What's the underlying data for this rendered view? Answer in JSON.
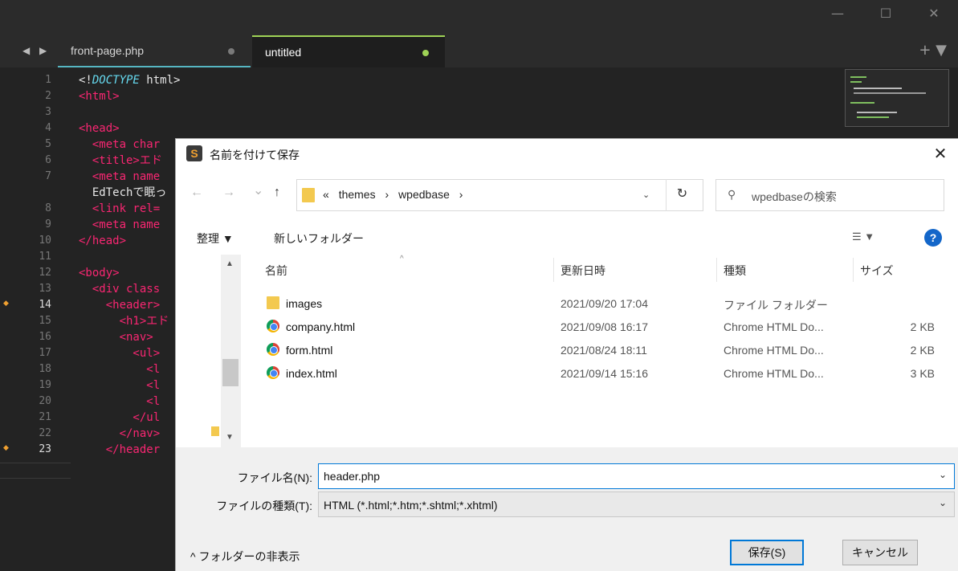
{
  "editor": {
    "window_controls": [
      "—",
      "☐",
      "✕"
    ],
    "nav_arrows": "◀ ▶",
    "tabs": [
      {
        "label": "front-page.php"
      },
      {
        "label": "untitled"
      }
    ],
    "tab_plus": "+ ▼",
    "line_numbers": [
      "1",
      "2",
      "3",
      "4",
      "5",
      "6",
      "7",
      "",
      "8",
      "9",
      "10",
      "11",
      "12",
      "13",
      "14",
      "15",
      "16",
      "17",
      "18",
      "19",
      "20",
      "21",
      "22",
      "23"
    ],
    "code_lines": [
      [
        "<!",
        "DOCTYPE",
        " html>"
      ],
      [
        "<html>"
      ],
      [
        ""
      ],
      [
        "<head>"
      ],
      [
        "  <meta char"
      ],
      [
        "  <title>エド"
      ],
      [
        "  <meta name"
      ],
      [
        "  EdTechで眠っ"
      ],
      [
        "  <link rel="
      ],
      [
        "  <meta name"
      ],
      [
        "</head>"
      ],
      [
        ""
      ],
      [
        "<body>"
      ],
      [
        "  <div class"
      ],
      [
        "    <header>"
      ],
      [
        "      <h1>エド"
      ],
      [
        "      <nav>"
      ],
      [
        "        <ul>"
      ],
      [
        "          <l"
      ],
      [
        "          <l"
      ],
      [
        "          <l"
      ],
      [
        "        </ul"
      ],
      [
        "      </nav>"
      ],
      [
        "    </header"
      ]
    ]
  },
  "dialog": {
    "logo": "S",
    "title": "名前を付けて保存",
    "close": "✕",
    "nav": {
      "back": "←",
      "forward": "→",
      "recent": "⌄",
      "up": "↑"
    },
    "breadcrumbs": [
      "«",
      "themes",
      "›",
      "wpedbase",
      "›"
    ],
    "address_dropdown": "⌄",
    "refresh": "↻",
    "search_icon": "⚲",
    "search_placeholder": "wpedbaseの検索",
    "toolbar": {
      "organize": "整理 ▼",
      "new_folder": "新しいフォルダー",
      "view": "☰ ▼",
      "help": "?"
    },
    "columns": {
      "name": "名前",
      "date": "更新日時",
      "type": "種類",
      "size": "サイズ"
    },
    "files": [
      {
        "name": "images",
        "date": "2021/09/20 17:04",
        "type": "ファイル フォルダー",
        "size": "",
        "icon": "folder-icon"
      },
      {
        "name": "company.html",
        "date": "2021/09/08 16:17",
        "type": "Chrome HTML Do...",
        "size": "2 KB",
        "icon": "chrome-icon"
      },
      {
        "name": "form.html",
        "date": "2021/08/24 18:11",
        "type": "Chrome HTML Do...",
        "size": "2 KB",
        "icon": "chrome-icon"
      },
      {
        "name": "index.html",
        "date": "2021/09/14 15:16",
        "type": "Chrome HTML Do...",
        "size": "3 KB",
        "icon": "chrome-icon"
      }
    ],
    "filename_label": "ファイル名(N):",
    "filename_value": "header.php",
    "filetype_label": "ファイルの種類(T):",
    "filetype_value": "HTML (*.html;*.htm;*.shtml;*.xhtml)",
    "hide_folders": "^ フォルダーの非表示",
    "save_label": "保存(S)",
    "cancel_label": "キャンセル"
  },
  "colors": {
    "accent": "#0078d7",
    "tab_active": "#9fd356",
    "tab_inactive_border": "#56b6c2",
    "tag": "#f92672"
  }
}
